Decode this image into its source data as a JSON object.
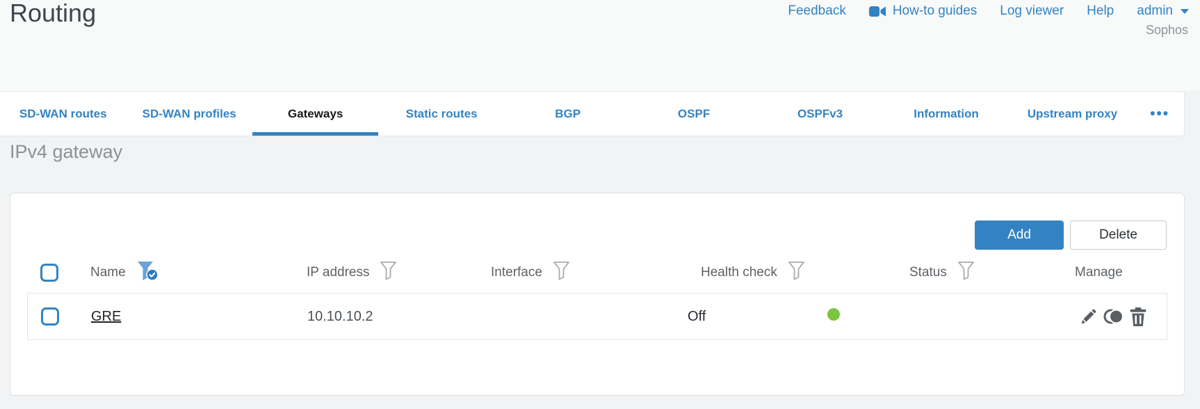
{
  "page": {
    "title": "Routing"
  },
  "brand": "Sophos",
  "header_links": {
    "feedback": "Feedback",
    "howto": "How-to guides",
    "log_viewer": "Log viewer",
    "help": "Help",
    "user": "admin"
  },
  "tabs": [
    {
      "label": "SD-WAN routes",
      "active": false
    },
    {
      "label": "SD-WAN profiles",
      "active": false
    },
    {
      "label": "Gateways",
      "active": true
    },
    {
      "label": "Static routes",
      "active": false
    },
    {
      "label": "BGP",
      "active": false
    },
    {
      "label": "OSPF",
      "active": false
    },
    {
      "label": "OSPFv3",
      "active": false
    },
    {
      "label": "Information",
      "active": false
    },
    {
      "label": "Upstream proxy",
      "active": false
    }
  ],
  "tabs_more_label": "•••",
  "section": {
    "heading": "IPv4 gateway"
  },
  "toolbar": {
    "add_label": "Add",
    "delete_label": "Delete"
  },
  "table": {
    "columns": [
      {
        "label": "Name",
        "filter": "active"
      },
      {
        "label": "IP address",
        "filter": "inactive"
      },
      {
        "label": "Interface",
        "filter": "inactive"
      },
      {
        "label": "Health check",
        "filter": "inactive"
      },
      {
        "label": "Status",
        "filter": "inactive"
      },
      {
        "label": "Manage",
        "filter": "none"
      }
    ],
    "rows": [
      {
        "name": "GRE",
        "ip_address": "10.10.10.2",
        "interface": "",
        "health_check": "Off",
        "status": "up",
        "manage": [
          "edit",
          "clone",
          "delete"
        ]
      }
    ]
  },
  "colors": {
    "accent_blue": "#3383c3",
    "status_green": "#7cc53e"
  }
}
